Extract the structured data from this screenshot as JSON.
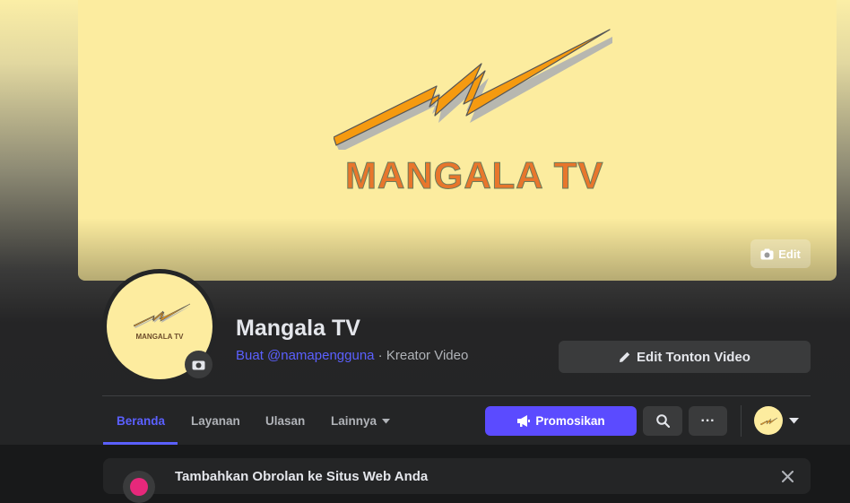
{
  "cover": {
    "brand_text": "MANGALA TV",
    "edit_label": "Edit",
    "edit_icon": "camera-icon"
  },
  "profile": {
    "avatar_text": "MANGALA TV",
    "name": "Mangala TV",
    "username_link": "Buat @namapengguna",
    "separator": " · ",
    "category": "Kreator Video",
    "edit_watch_label": "Edit Tonton Video",
    "edit_watch_icon": "pencil-icon"
  },
  "tabs": [
    {
      "label": "Beranda",
      "active": true
    },
    {
      "label": "Layanan"
    },
    {
      "label": "Ulasan"
    },
    {
      "label": "Lainnya",
      "icon": "caret-down-icon"
    }
  ],
  "actions": {
    "promote_label": "Promosikan",
    "promote_icon": "megaphone-icon",
    "search_icon": "search-icon",
    "more_label": "···",
    "account_caret_icon": "caret-down-icon"
  },
  "chat_card": {
    "title": "Tambahkan Obrolan ke Situs Web Anda",
    "close_icon": "close-icon"
  },
  "colors": {
    "accent": "#5b60ff",
    "promote": "#5b4bff",
    "brand_orange": "#f59a10",
    "cover_bg": "#fcec9f"
  }
}
